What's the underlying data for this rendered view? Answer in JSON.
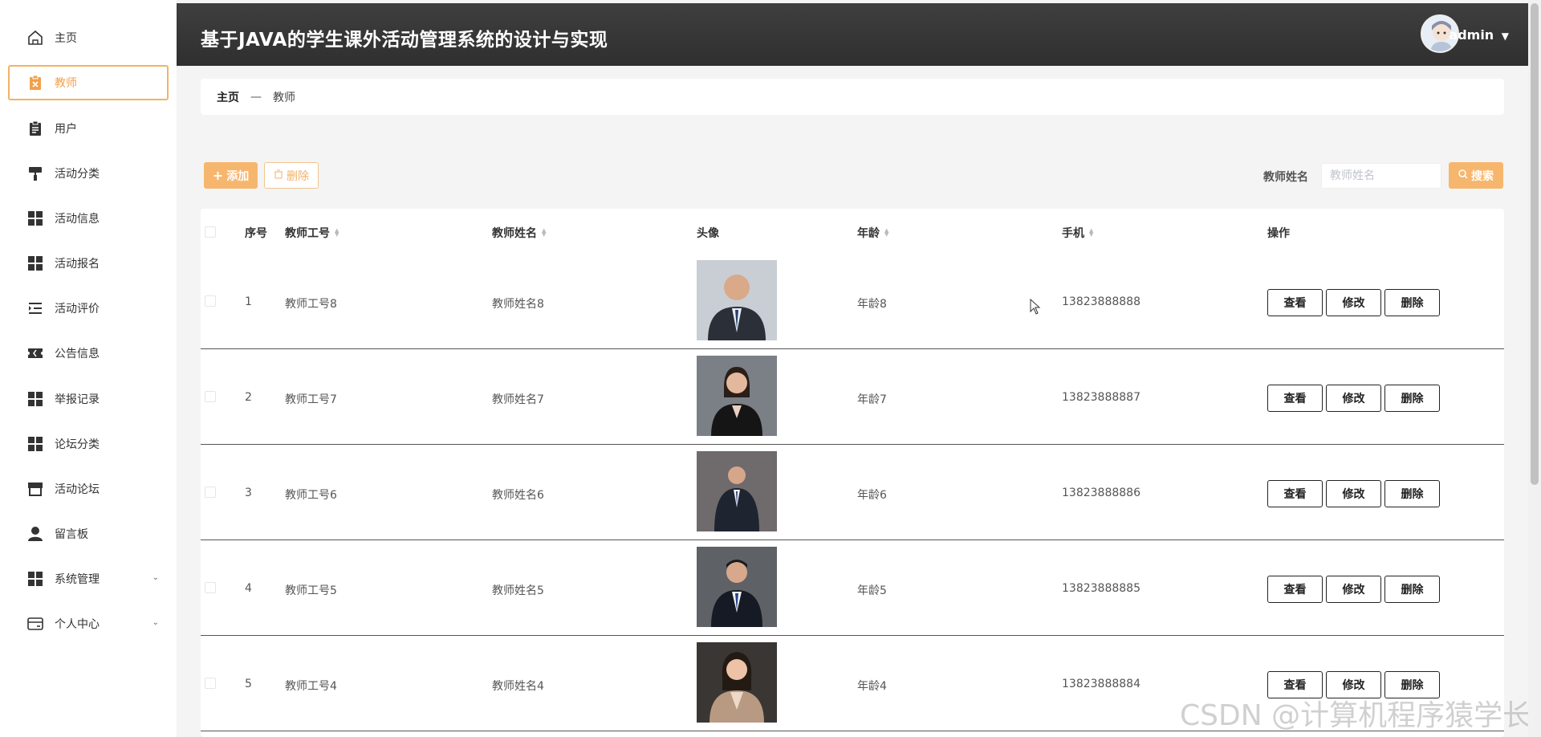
{
  "header": {
    "title": "基于JAVA的学生课外活动管理系统的设计与实现",
    "username": "admin"
  },
  "sidebar": {
    "items": [
      {
        "label": "主页",
        "icon": "home-icon"
      },
      {
        "label": "教师",
        "icon": "clipboard-x-icon",
        "active": true
      },
      {
        "label": "用户",
        "icon": "clipboard-icon"
      },
      {
        "label": "活动分类",
        "icon": "paint-roller-icon"
      },
      {
        "label": "活动信息",
        "icon": "grid-icon"
      },
      {
        "label": "活动报名",
        "icon": "grid-icon"
      },
      {
        "label": "活动评价",
        "icon": "list-indent-icon"
      },
      {
        "label": "公告信息",
        "icon": "ticket-icon"
      },
      {
        "label": "举报记录",
        "icon": "grid-icon"
      },
      {
        "label": "论坛分类",
        "icon": "grid-icon"
      },
      {
        "label": "活动论坛",
        "icon": "store-icon"
      },
      {
        "label": "留言板",
        "icon": "user-icon"
      },
      {
        "label": "系统管理",
        "icon": "grid-icon",
        "expandable": true
      },
      {
        "label": "个人中心",
        "icon": "card-icon",
        "expandable": true
      }
    ]
  },
  "breadcrumb": {
    "home": "主页",
    "separator": "—",
    "current": "教师"
  },
  "toolbar": {
    "add_label": "添加",
    "delete_label": "删除",
    "search_label": "教师姓名",
    "search_placeholder": "教师姓名",
    "search_button": "搜索"
  },
  "table": {
    "headers": {
      "index": "序号",
      "teacher_no": "教师工号",
      "teacher_name": "教师姓名",
      "avatar": "头像",
      "age": "年龄",
      "phone": "手机",
      "actions": "操作"
    },
    "rows": [
      {
        "index": "1",
        "teacher_no": "教师工号8",
        "teacher_name": "教师姓名8",
        "age": "年龄8",
        "phone": "13823888888"
      },
      {
        "index": "2",
        "teacher_no": "教师工号7",
        "teacher_name": "教师姓名7",
        "age": "年龄7",
        "phone": "13823888887"
      },
      {
        "index": "3",
        "teacher_no": "教师工号6",
        "teacher_name": "教师姓名6",
        "age": "年龄6",
        "phone": "13823888886"
      },
      {
        "index": "4",
        "teacher_no": "教师工号5",
        "teacher_name": "教师姓名5",
        "age": "年龄5",
        "phone": "13823888885"
      },
      {
        "index": "5",
        "teacher_no": "教师工号4",
        "teacher_name": "教师姓名4",
        "age": "年龄4",
        "phone": "13823888884"
      }
    ],
    "action_labels": {
      "view": "查看",
      "edit": "修改",
      "delete": "删除"
    }
  },
  "watermark": "CSDN @计算机程序猿学长",
  "colors": {
    "accent": "#f7b66d",
    "header_bg": "#383838",
    "sidebar_active": "#f2a04a"
  }
}
